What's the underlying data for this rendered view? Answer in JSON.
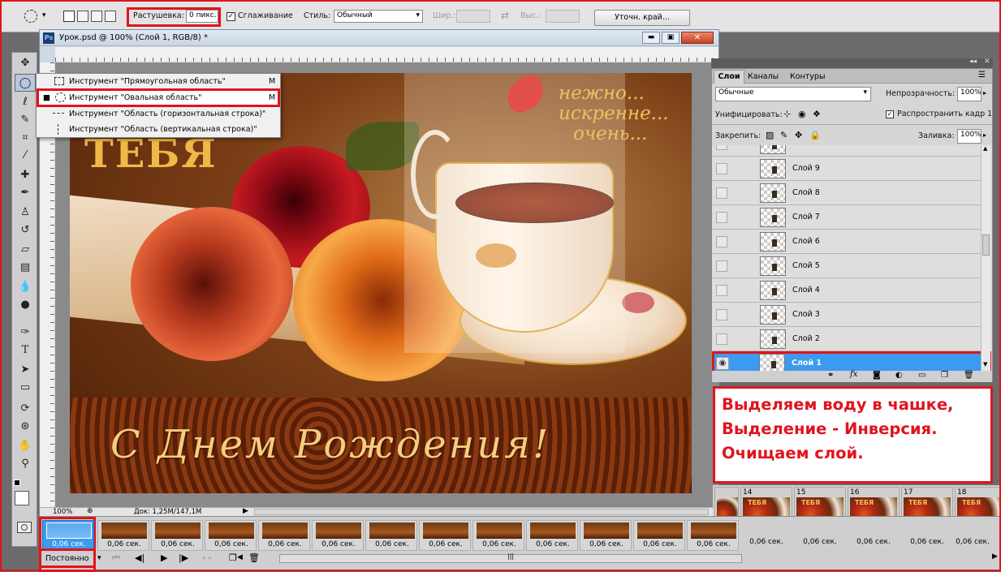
{
  "options_bar": {
    "feather_label": "Растушевка:",
    "feather_value": "0 пикс.",
    "antialias_label": "Сглаживание",
    "style_label": "Стиль:",
    "style_value": "Обычный",
    "width_label": "Шир.:",
    "height_label": "Выс.:",
    "refine_button": "Уточн. край..."
  },
  "document": {
    "ps_badge": "Ps",
    "title": "Урок.psd @ 100% (Слой 1, RGB/8) *",
    "zoom": "100%",
    "doc_size": "Док: 1,25M/147,1M"
  },
  "flyout": {
    "items": [
      {
        "label": "Инструмент \"Прямоугольная область\"",
        "shortcut": "M"
      },
      {
        "label": "Инструмент \"Овальная область\"",
        "shortcut": "M"
      },
      {
        "label": "Инструмент \"Область (горизонтальная строка)\"",
        "shortcut": ""
      },
      {
        "label": "Инструмент \"Область (вертикальная строка)\"",
        "shortcut": ""
      }
    ]
  },
  "canvas_text": {
    "tebya": "ТЕБЯ",
    "tagline_1": "нежно...",
    "tagline_2": "искренне...",
    "tagline_3": "очень...",
    "birthday": "С Днем Рождения!"
  },
  "layers_panel": {
    "tabs": [
      "Слои",
      "Каналы",
      "Контуры"
    ],
    "blend_mode": "Обычные",
    "opacity_label": "Непрозрачность:",
    "opacity_value": "100%",
    "unify_label": "Унифицировать:",
    "propagate_label": "Распространить кадр 1",
    "lock_label": "Закрепить:",
    "fill_label": "Заливка:",
    "fill_value": "100%",
    "layers": [
      "Слой 9",
      "Слой 8",
      "Слой 7",
      "Слой 6",
      "Слой 5",
      "Слой 4",
      "Слой 3",
      "Слой 2",
      "Слой 1"
    ],
    "selected_layer": "Слой 1"
  },
  "note": {
    "line1": "Выделяем воду в чашке,",
    "line2": "Выделение - Инверсия.",
    "line3": "Очищаем слой."
  },
  "animation": {
    "frame_times": [
      "0,06 сек.",
      "0,06 сек.",
      "0,06 сек.",
      "0,06 сек.",
      "0,06 сек.",
      "0,06 сек.",
      "0,06 сек.",
      "0,06 сек.",
      "0,06 сек.",
      "0,06 сек.",
      "0,06 сек.",
      "0,06 сек.",
      "0,06 сек.",
      "0,06 сек.",
      "0,06 сек.",
      "0,06 сек.",
      "0,06 сек.",
      "0,06 сек."
    ],
    "frame_numbers": [
      "14",
      "15",
      "16",
      "17",
      "18"
    ],
    "loop_value": "Постоянно"
  },
  "colors": {
    "accent_red": "#e0141e",
    "selection_blue": "#3b9bf0"
  }
}
